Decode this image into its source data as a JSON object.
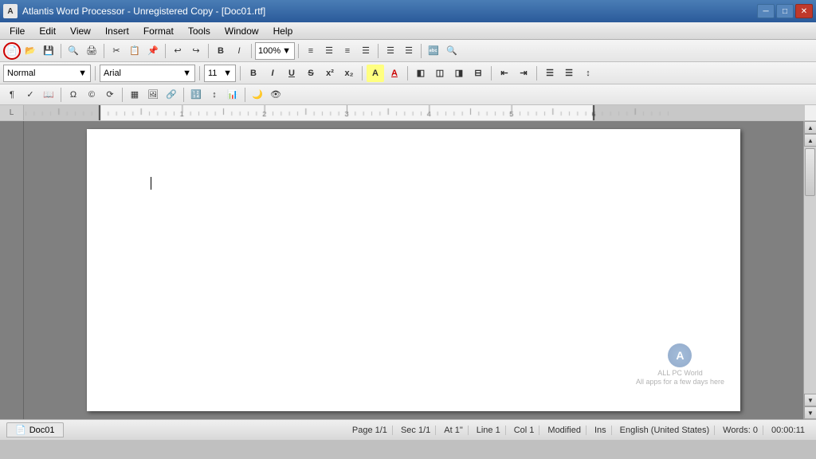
{
  "titlebar": {
    "title": "Atlantis Word Processor - Unregistered Copy - [Doc01.rtf]",
    "app_icon": "A",
    "minimize": "─",
    "maximize": "□",
    "close": "✕"
  },
  "menubar": {
    "items": [
      "File",
      "Edit",
      "View",
      "Insert",
      "Format",
      "Tools",
      "Window",
      "Help"
    ]
  },
  "toolbar1": {
    "zoom_value": "100%",
    "zoom_label": "100%"
  },
  "toolbar2": {
    "style": "Normal",
    "font": "Arial",
    "size": "11",
    "bold": "B",
    "italic": "I",
    "underline": "U"
  },
  "ruler": {
    "unit": "L"
  },
  "status": {
    "page": "Page 1/1",
    "sec": "Sec 1/1",
    "at": "At 1\"",
    "line": "Line 1",
    "col": "Col 1",
    "modified": "Modified",
    "ins": "Ins",
    "language": "English (United States)",
    "words": "Words: 0",
    "time": "00:00:11",
    "doc_tab": "Doc01"
  },
  "watermark": {
    "logo": "A",
    "line1": "ALL PC World",
    "line2": "All apps for a few days here"
  }
}
